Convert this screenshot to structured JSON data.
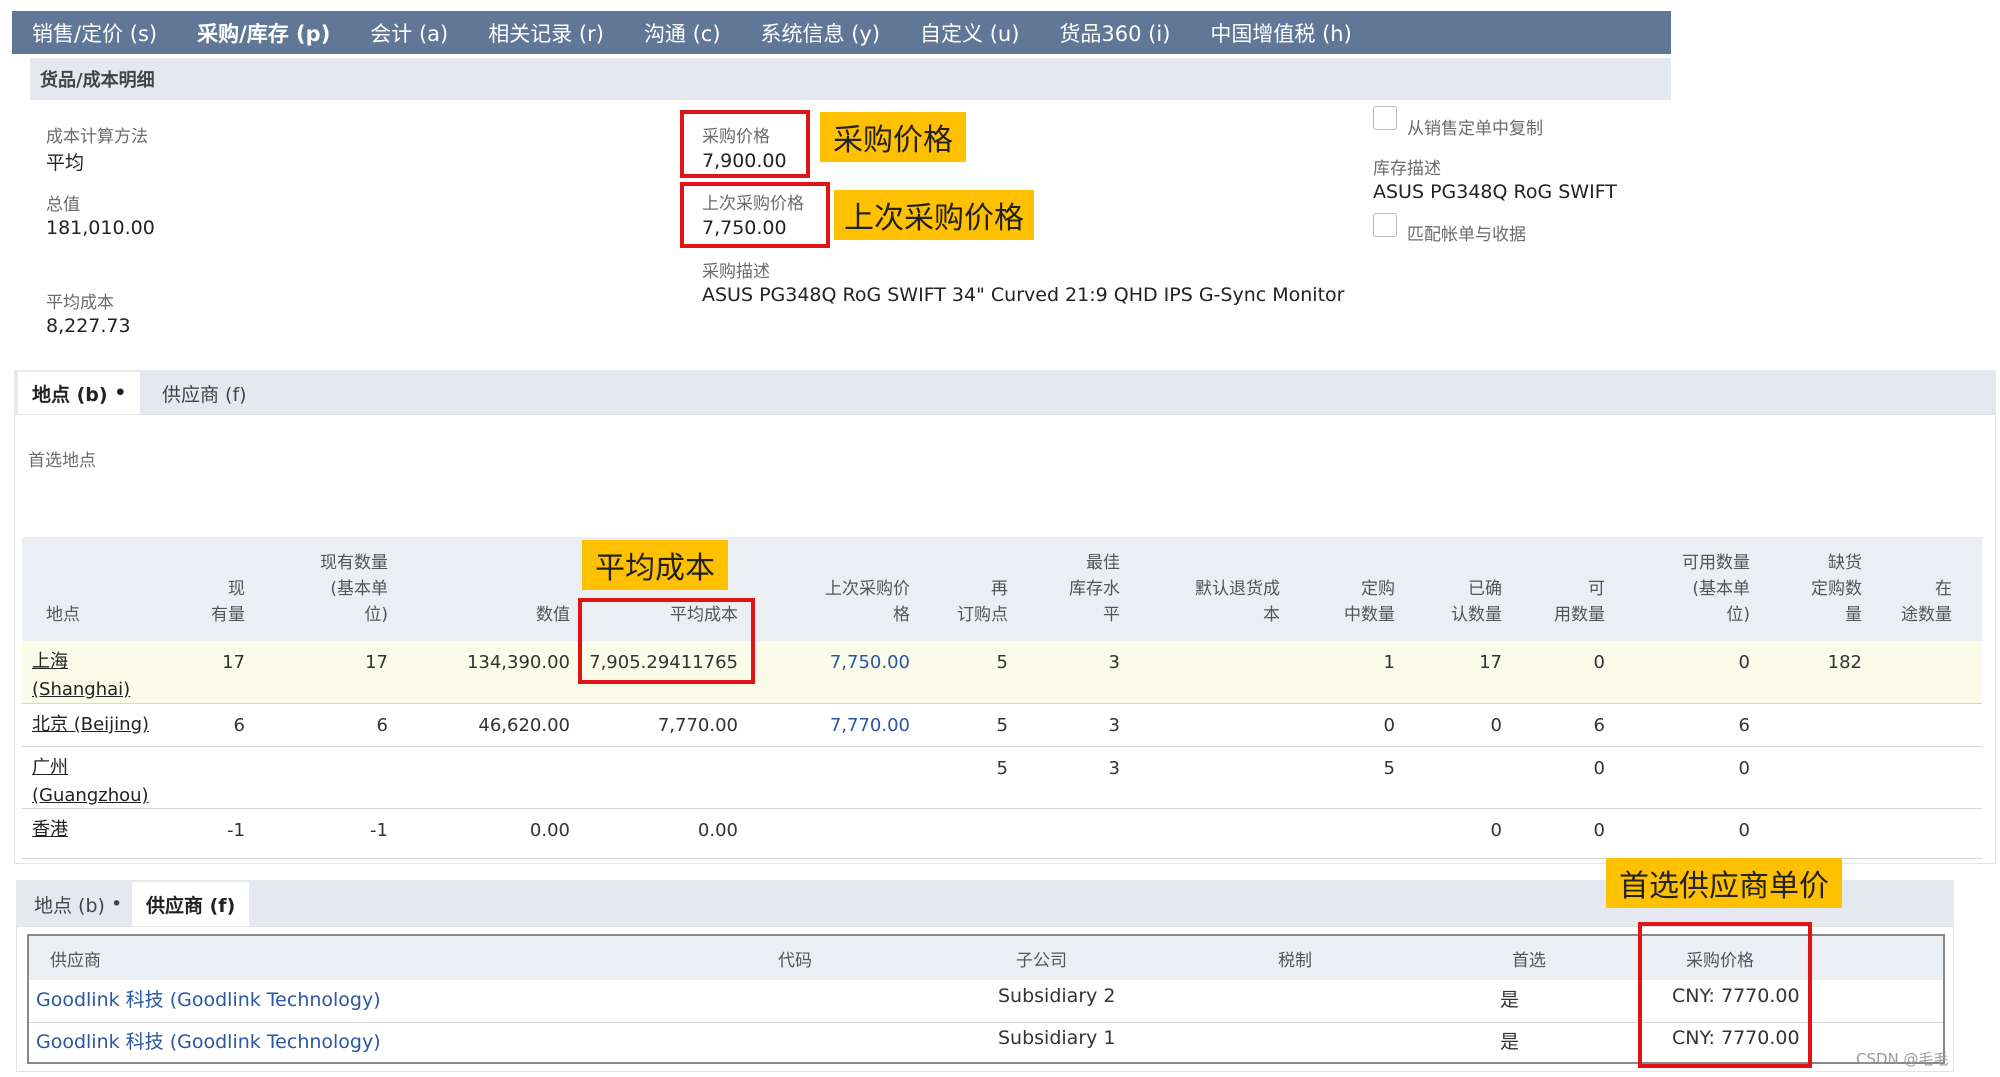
{
  "tabs": [
    "销售/定价 (s)",
    "采购/库存 (p)",
    "会计 (a)",
    "相关记录 (r)",
    "沟通 (c)",
    "系统信息 (y)",
    "自定义 (u)",
    "货品360 (i)",
    "中国增值税 (h)"
  ],
  "section_title": "货品/成本明细",
  "left_fields": {
    "cost_method_label": "成本计算方法",
    "cost_method_value": "平均",
    "total_label": "总值",
    "total_value": "181,010.00",
    "avg_cost_label": "平均成本",
    "avg_cost_value": "8,227.73"
  },
  "mid_fields": {
    "purchase_price_label": "采购价格",
    "purchase_price_value": "7,900.00",
    "last_purchase_price_label": "上次采购价格",
    "last_purchase_price_value": "7,750.00",
    "purchase_desc_label": "采购描述",
    "purchase_desc_value": "ASUS PG348Q RoG SWIFT 34\" Curved 21:9 QHD IPS G-Sync Monitor"
  },
  "right_fields": {
    "copy_from_so_label": "从销售定单中复制",
    "stock_desc_label": "库存描述",
    "stock_desc_value": "ASUS PG348Q RoG SWIFT",
    "match_bill_label": "匹配帐单与收据"
  },
  "callouts": {
    "purchase_price": "采购价格",
    "last_purchase_price": "上次采购价格",
    "avg_cost": "平均成本",
    "preferred_vendor_price": "首选供应商单价"
  },
  "locations_panel": {
    "subtab_locations": "地点 (b)",
    "subtab_vendors": "供应商 (f)",
    "preferred_location_label": "首选地点",
    "headers": [
      "地点",
      "现\n有量",
      "现有数量\n(基本单\n位)",
      "数值",
      "平均成本",
      "上次采购价\n格",
      "再\n订购点",
      "最佳\n库存水\n平",
      "默认退货成\n本",
      "定购\n中数量",
      "已确\n认数量",
      "可\n用数量",
      "可用数量\n(基本单\n位)",
      "缺货\n定购数\n量",
      "在\n途数量"
    ],
    "rows": [
      {
        "location": "上海\n(Shanghai)",
        "on_hand": "17",
        "on_hand_base": "17",
        "value": "134,390.00",
        "avg_cost": "7,905.29411765",
        "last_price": "7,750.00",
        "reorder": "5",
        "preferred_stock": "3",
        "return_cost": "",
        "on_order": "1",
        "committed": "17",
        "available": "0",
        "available_base": "0",
        "backordered": "182",
        "in_transit": ""
      },
      {
        "location": "北京 (Beijing)",
        "on_hand": "6",
        "on_hand_base": "6",
        "value": "46,620.00",
        "avg_cost": "7,770.00",
        "last_price": "7,770.00",
        "reorder": "5",
        "preferred_stock": "3",
        "return_cost": "",
        "on_order": "0",
        "committed": "0",
        "available": "6",
        "available_base": "6",
        "backordered": "",
        "in_transit": ""
      },
      {
        "location": "广州\n(Guangzhou)",
        "on_hand": "",
        "on_hand_base": "",
        "value": "",
        "avg_cost": "",
        "last_price": "",
        "reorder": "5",
        "preferred_stock": "3",
        "return_cost": "",
        "on_order": "5",
        "committed": "",
        "available": "0",
        "available_base": "0",
        "backordered": "",
        "in_transit": ""
      },
      {
        "location": "香港",
        "on_hand": "-1",
        "on_hand_base": "-1",
        "value": "0.00",
        "avg_cost": "0.00",
        "last_price": "",
        "reorder": "",
        "preferred_stock": "",
        "return_cost": "",
        "on_order": "",
        "committed": "0",
        "available": "0",
        "available_base": "0",
        "backordered": "",
        "in_transit": ""
      }
    ]
  },
  "vendors_panel": {
    "subtab_locations": "地点 (b)",
    "subtab_vendors": "供应商 (f)",
    "headers": {
      "vendor": "供应商",
      "code": "代码",
      "subsidiary": "子公司",
      "tax": "税制",
      "preferred": "首选",
      "price": "采购价格"
    },
    "rows": [
      {
        "vendor": "Goodlink 科技 (Goodlink Technology)",
        "code": "",
        "subsidiary": "Subsidiary 2",
        "tax": "",
        "preferred": "是",
        "price": "CNY: 7770.00"
      },
      {
        "vendor": "Goodlink 科技 (Goodlink Technology)",
        "code": "",
        "subsidiary": "Subsidiary 1",
        "tax": "",
        "preferred": "是",
        "price": "CNY: 7770.00"
      }
    ]
  },
  "watermark": "CSDN @毛毛"
}
